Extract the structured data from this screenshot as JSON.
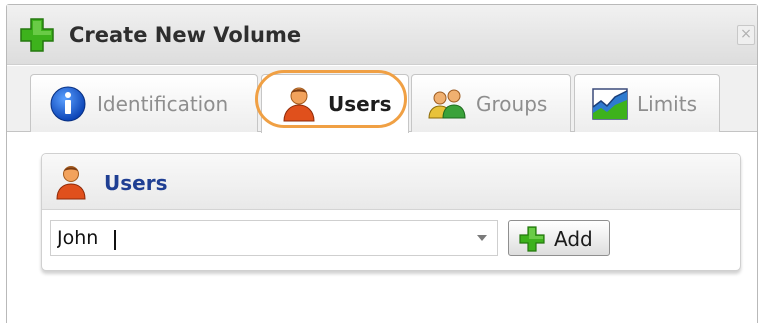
{
  "dialog": {
    "title": "Create New Volume",
    "close_glyph": "×"
  },
  "tabs": [
    {
      "label": "Identification",
      "icon": "info-icon",
      "active": false
    },
    {
      "label": "Users",
      "icon": "user-icon",
      "active": true
    },
    {
      "label": "Groups",
      "icon": "group-icon",
      "active": false
    },
    {
      "label": "Limits",
      "icon": "chart-icon",
      "active": false
    }
  ],
  "panel": {
    "title": "Users",
    "icon": "user-icon",
    "user_input_value": "John",
    "add_label": "Add"
  },
  "colors": {
    "accent_highlight": "#f0a044",
    "panel_title": "#1f3f93",
    "plus_green": "#3db21c"
  }
}
